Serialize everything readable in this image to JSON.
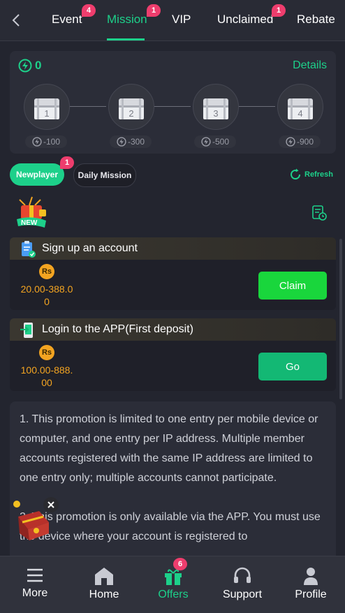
{
  "header": {
    "tabs": [
      {
        "label": "Event",
        "badge": "4"
      },
      {
        "label": "Mission",
        "badge": "1",
        "active": true
      },
      {
        "label": "VIP"
      },
      {
        "label": "Unclaimed",
        "badge": "1"
      },
      {
        "label": "Rebate"
      }
    ]
  },
  "progress": {
    "energy": "0",
    "details_label": "Details",
    "chests": [
      {
        "number": "1",
        "cost": "-100"
      },
      {
        "number": "2",
        "cost": "-300"
      },
      {
        "number": "3",
        "cost": "-500"
      },
      {
        "number": "4",
        "cost": "-900"
      }
    ]
  },
  "mission_tabs": {
    "newplayer": "Newplayer",
    "newplayer_badge": "1",
    "daily": "Daily Mission",
    "refresh": "Refresh"
  },
  "section": {
    "new_badge": "NEW"
  },
  "tasks": [
    {
      "title": "Sign up an account",
      "currency": "Rs",
      "amount_line1": "20.00-388.0",
      "amount_line2": "0",
      "button": "Claim"
    },
    {
      "title": "Login to the APP(First deposit)",
      "currency": "Rs",
      "amount_line1": "100.00-888.",
      "amount_line2": "00",
      "button": "Go"
    }
  ],
  "description": {
    "p1": "1. This promotion is limited to one entry per mobile device or computer, and one entry per IP address. Multiple member accounts registered with the same IP address are limited to one entry only; multiple accounts cannot participate.",
    "p2": "2. This promotion is only available via the APP. You must use the device where your account is registered to"
  },
  "bottom_nav": {
    "more": "More",
    "home": "Home",
    "offers": "Offers",
    "offers_badge": "6",
    "support": "Support",
    "profile": "Profile"
  },
  "colors": {
    "accent": "#1dd08a",
    "claim_button": "#19d63c",
    "go_button": "#13b874",
    "badge": "#ee3d6d",
    "currency": "#f3a421"
  },
  "icons": [
    "back-arrow-icon",
    "lightning-icon",
    "chest-icon",
    "refresh-icon",
    "history-icon",
    "register-icon",
    "app-login-icon",
    "menu-icon",
    "home-icon",
    "gift-icon",
    "headset-icon",
    "profile-icon",
    "close-icon"
  ]
}
